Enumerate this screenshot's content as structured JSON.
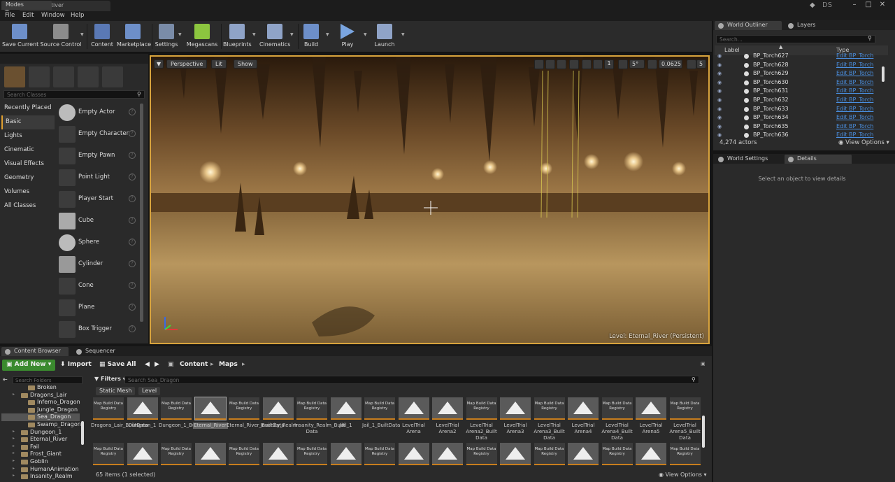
{
  "window": {
    "tab_title": "Eternal_River",
    "user_badge": "DS"
  },
  "menu": [
    "File",
    "Edit",
    "Window",
    "Help"
  ],
  "toolbar": [
    {
      "label": "Save Current",
      "color": "#6d8fc9"
    },
    {
      "label": "Source Control",
      "color": "#8c8c8c"
    },
    {
      "label": "Content",
      "color": "#5a79b5"
    },
    {
      "label": "Marketplace",
      "color": "#6d8fc9"
    },
    {
      "label": "Settings",
      "color": "#7a8ca8"
    },
    {
      "label": "Megascans",
      "color": "#8cc63f"
    },
    {
      "label": "Blueprints",
      "color": "#8fa3c7"
    },
    {
      "label": "Cinematics",
      "color": "#8fa3c7"
    },
    {
      "label": "Build",
      "color": "#6d8fc9"
    },
    {
      "label": "Play",
      "color": "#7aa5e0"
    },
    {
      "label": "Launch",
      "color": "#8fa3c7"
    }
  ],
  "modes": {
    "tab": "Modes",
    "search_placeholder": "Search Classes",
    "categories": [
      "Recently Placed",
      "Basic",
      "Lights",
      "Cinematic",
      "Visual Effects",
      "Geometry",
      "Volumes",
      "All Classes"
    ],
    "items": [
      "Empty Actor",
      "Empty Character",
      "Empty Pawn",
      "Point Light",
      "Player Start",
      "Cube",
      "Sphere",
      "Cylinder",
      "Cone",
      "Plane",
      "Box Trigger"
    ]
  },
  "viewport": {
    "perspective": "Perspective",
    "lit": "Lit",
    "show": "Show",
    "angle": "5°",
    "scale": "0.0625",
    "camera_speed": "5",
    "level_label": "Level:  Eternal_River (Persistent)"
  },
  "outliner": {
    "tabs": [
      "World Outliner",
      "Layers"
    ],
    "search_placeholder": "Search...",
    "col_label": "Label",
    "col_type": "Type",
    "rows": [
      {
        "name": "BP_Torch627",
        "type": "Edit BP_Torch"
      },
      {
        "name": "BP_Torch628",
        "type": "Edit BP_Torch"
      },
      {
        "name": "BP_Torch629",
        "type": "Edit BP_Torch"
      },
      {
        "name": "BP_Torch630",
        "type": "Edit BP_Torch"
      },
      {
        "name": "BP_Torch631",
        "type": "Edit BP_Torch"
      },
      {
        "name": "BP_Torch632",
        "type": "Edit BP_Torch"
      },
      {
        "name": "BP_Torch633",
        "type": "Edit BP_Torch"
      },
      {
        "name": "BP_Torch634",
        "type": "Edit BP_Torch"
      },
      {
        "name": "BP_Torch635",
        "type": "Edit BP_Torch"
      },
      {
        "name": "BP_Torch636",
        "type": "Edit BP_Torch"
      }
    ],
    "actor_count": "4,274 actors",
    "view_options": "View Options"
  },
  "details": {
    "tabs": [
      "World Settings",
      "Details"
    ],
    "empty_message": "Select an object to view details"
  },
  "content_browser": {
    "tabs": [
      "Content Browser",
      "Sequencer"
    ],
    "add_new": "Add New",
    "import": "Import",
    "save_all": "Save All",
    "path": [
      "Content",
      "Maps"
    ],
    "folder_search_placeholder": "Search Folders",
    "filters": "Filters",
    "asset_search_placeholder": "Search Sea_Dragon",
    "chips": [
      "Static Mesh",
      "Level"
    ],
    "tree": [
      {
        "name": "Broken",
        "depth": 2,
        "selected": false
      },
      {
        "name": "Dragons_Lair",
        "depth": 1,
        "selected": false
      },
      {
        "name": "Inferno_Dragon",
        "depth": 2,
        "selected": false
      },
      {
        "name": "Jungle_Dragon",
        "depth": 2,
        "selected": false
      },
      {
        "name": "Sea_Dragon",
        "depth": 2,
        "selected": true
      },
      {
        "name": "Swamp_Dragon",
        "depth": 2,
        "selected": false
      },
      {
        "name": "Dungeon_1",
        "depth": 1,
        "selected": false
      },
      {
        "name": "Eternal_River",
        "depth": 1,
        "selected": false
      },
      {
        "name": "Fail",
        "depth": 1,
        "selected": false
      },
      {
        "name": "Frost_Giant",
        "depth": 1,
        "selected": false
      },
      {
        "name": "Goblin",
        "depth": 1,
        "selected": false
      },
      {
        "name": "HumanAnimation",
        "depth": 1,
        "selected": false
      },
      {
        "name": "Insanity_Realm",
        "depth": 1,
        "selected": false
      }
    ],
    "registry_label": "Map Build Data Registry",
    "assets": [
      {
        "name": "Dragons_Lair_BuiltData",
        "kind": "reg"
      },
      {
        "name": "Dungeon_1",
        "kind": "map"
      },
      {
        "name": "Dungeon_1_BuiltData",
        "kind": "reg"
      },
      {
        "name": "Eternal_River",
        "kind": "map",
        "selected": true
      },
      {
        "name": "Eternal_River_BuiltData",
        "kind": "reg"
      },
      {
        "name": "Insanity_Realm",
        "kind": "map"
      },
      {
        "name": "Insanity_Realm_Built Data",
        "kind": "reg"
      },
      {
        "name": "Jail_1",
        "kind": "map"
      },
      {
        "name": "Jail_1_BuiltData",
        "kind": "reg"
      },
      {
        "name": "LevelTrial Arena",
        "kind": "map"
      },
      {
        "name": "LevelTrial Arena2",
        "kind": "map"
      },
      {
        "name": "LevelTrial Arena2_Built Data",
        "kind": "reg"
      },
      {
        "name": "LevelTrial Arena3",
        "kind": "map"
      },
      {
        "name": "LevelTrial Arena3_Built Data",
        "kind": "reg"
      },
      {
        "name": "LevelTrial Arena4",
        "kind": "map"
      },
      {
        "name": "LevelTrial Arena4_Built Data",
        "kind": "reg"
      },
      {
        "name": "LevelTrial Arena5",
        "kind": "map"
      },
      {
        "name": "LevelTrial Arena5_Built Data",
        "kind": "reg"
      }
    ],
    "status": "65 items (1 selected)",
    "view_options": "View Options"
  }
}
